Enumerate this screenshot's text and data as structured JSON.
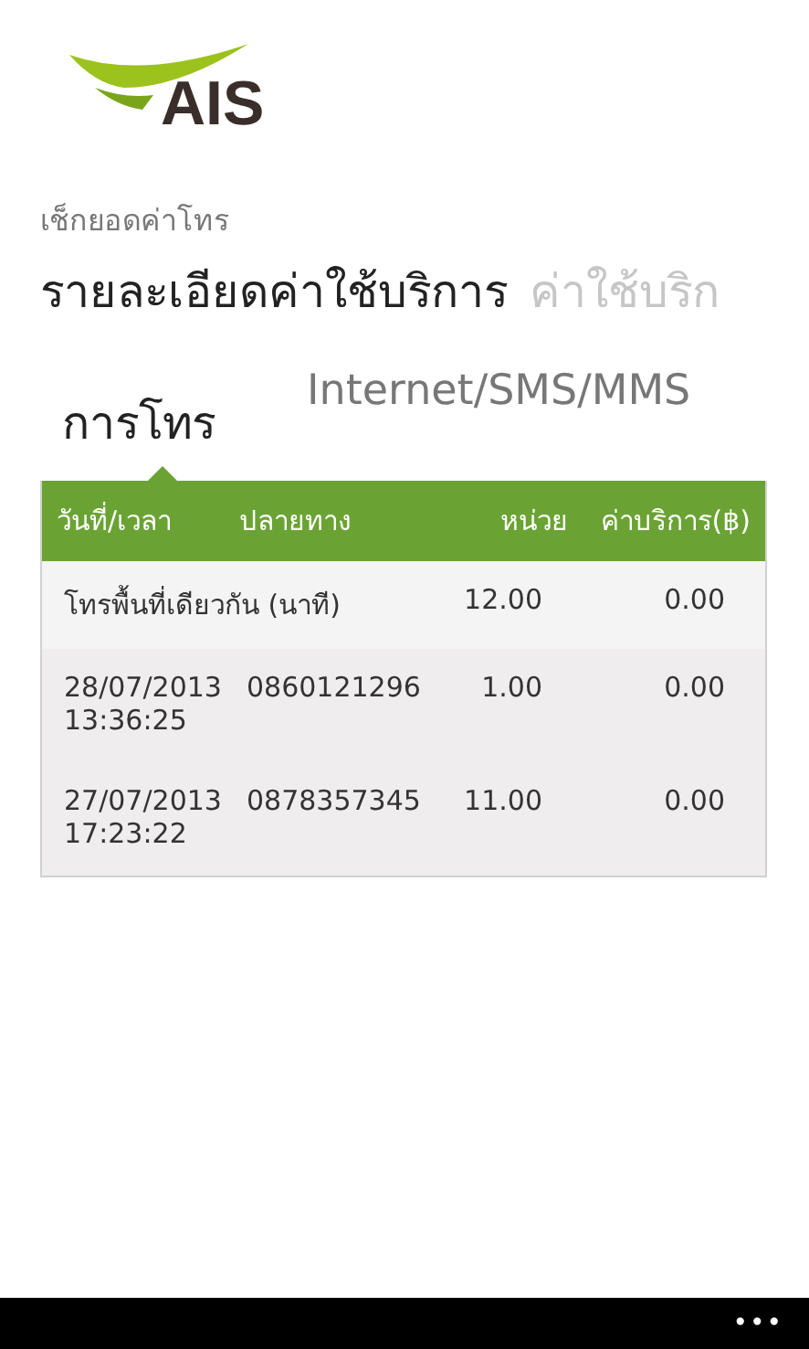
{
  "logo": {
    "text": "AIS"
  },
  "app_title": "เช็กยอดค่าโทร",
  "pivots": [
    {
      "label": "รายละเอียดค่าใช้บริการ",
      "selected": true
    },
    {
      "label": "ค่าใช้บริก",
      "selected": false
    }
  ],
  "tabs": [
    {
      "label": "การโทร",
      "selected": true
    },
    {
      "label": "Internet/SMS/MMS",
      "selected": false
    }
  ],
  "table": {
    "columns": [
      "วันที่/เวลา",
      "ปลายทาง",
      "หน่วย",
      "ค่าบริการ(฿)"
    ],
    "rows": [
      {
        "kind": "summary",
        "label": "โทรพื้นที่เดียวกัน (นาที)",
        "units": "12.00",
        "charge": "0.00"
      },
      {
        "kind": "call",
        "date": "28/07/2013",
        "time": "13:36:25",
        "number": "0860121296",
        "units": "1.00",
        "charge": "0.00"
      },
      {
        "kind": "call",
        "date": "27/07/2013",
        "time": "17:23:22",
        "number": "0878357345",
        "units": "11.00",
        "charge": "0.00"
      }
    ]
  },
  "app_bar": {
    "more": "•••"
  }
}
